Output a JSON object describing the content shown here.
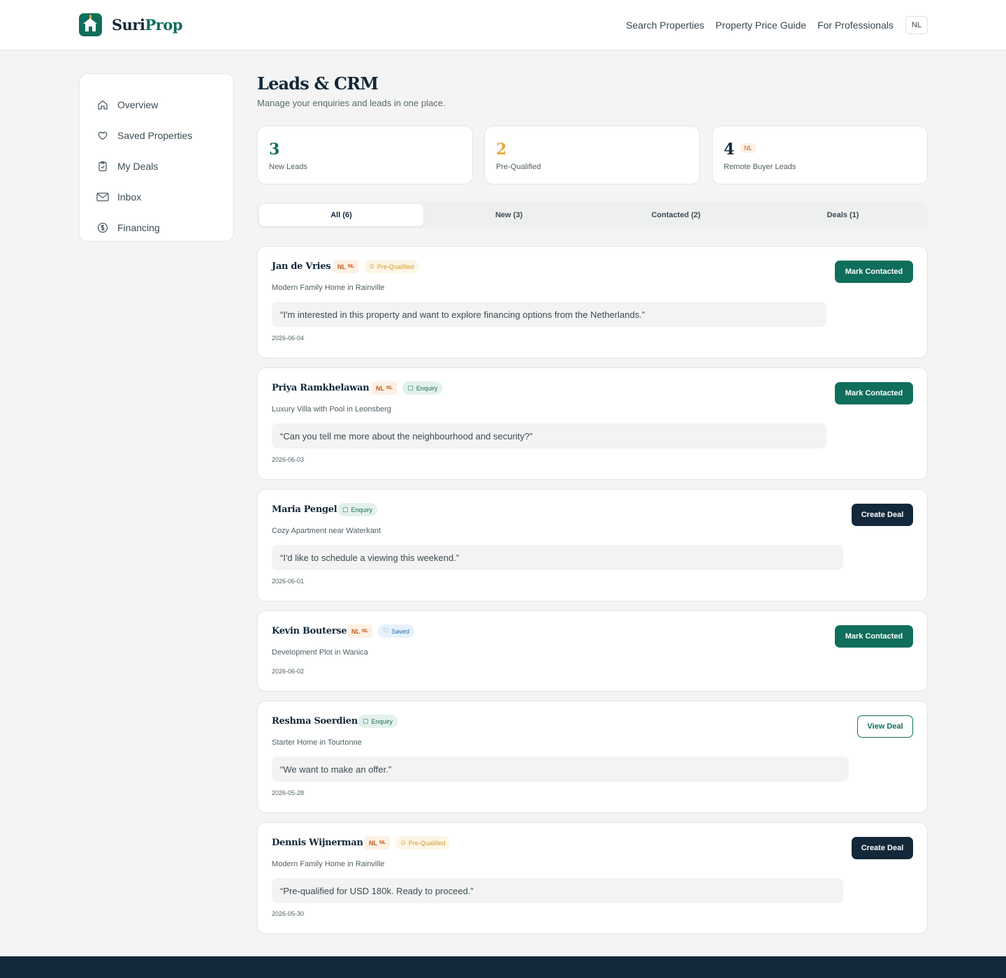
{
  "brand": {
    "name_a": "Suri",
    "name_b": "Prop"
  },
  "nav": {
    "links": [
      "Search Properties",
      "Property Price Guide",
      "For Professionals"
    ],
    "lang": "NL"
  },
  "sidebar": {
    "items": [
      {
        "label": "Overview",
        "icon": "home-icon"
      },
      {
        "label": "Saved Properties",
        "icon": "heart-icon"
      },
      {
        "label": "My Deals",
        "icon": "clipboard-check-icon"
      },
      {
        "label": "Inbox",
        "icon": "mail-icon"
      },
      {
        "label": "Financing",
        "icon": "dollar-circle-icon"
      }
    ]
  },
  "page": {
    "title": "Leads & CRM",
    "subtitle": "Manage your enquiries and leads in one place."
  },
  "stats": [
    {
      "value": "3",
      "label": "New Leads",
      "color": "#0f6e5c"
    },
    {
      "value": "2",
      "label": "Pre-Qualified",
      "color": "#e5a93a"
    },
    {
      "value": "4",
      "label": "Remote Buyer Leads",
      "color": "#13283a",
      "badge": "NL"
    }
  ],
  "tabs": [
    "All (6)",
    "New (3)",
    "Contacted (2)",
    "Deals (1)"
  ],
  "leads": [
    {
      "name": "Jan de Vries",
      "nl": true,
      "status": "Pre-Qualified",
      "status_type": "preq",
      "property": "Modern Family Home in Rainville",
      "message": "“I'm interested in this property and want to explore financing options from the Netherlands.”",
      "date": "2026-06-04",
      "action": "Mark Contacted",
      "action_type": "green"
    },
    {
      "name": "Priya Ramkhelawan",
      "nl": true,
      "status": "Enquiry",
      "status_type": "enq",
      "property": "Luxury Villa with Pool in Leonsberg",
      "message": "“Can you tell me more about the neighbourhood and security?”",
      "date": "2026-06-03",
      "action": "Mark Contacted",
      "action_type": "green"
    },
    {
      "name": "Maria Pengel",
      "nl": false,
      "status": "Enquiry",
      "status_type": "enq",
      "property": "Cozy Apartment near Waterkant",
      "message": "“I'd like to schedule a viewing this weekend.”",
      "date": "2026-06-01",
      "action": "Create Deal",
      "action_type": "dark"
    },
    {
      "name": "Kevin Bouterse",
      "nl": true,
      "status": "Saved",
      "status_type": "saved",
      "property": "Development Plot in Wanica",
      "message": "",
      "date": "2026-06-02",
      "action": "Mark Contacted",
      "action_type": "green"
    },
    {
      "name": "Reshma Soerdien",
      "nl": false,
      "status": "Enquiry",
      "status_type": "enq",
      "property": "Starter Home in Tourtonne",
      "message": "“We want to make an offer.”",
      "date": "2026-05-28",
      "action": "View Deal",
      "action_type": "outline"
    },
    {
      "name": "Dennis Wijnerman",
      "nl": true,
      "status": "Pre-Qualified",
      "status_type": "preq",
      "property": "Modern Family Home in Rainville",
      "message": "“Pre-qualified for USD 180k. Ready to proceed.”",
      "date": "2026-05-30",
      "action": "Create Deal",
      "action_type": "dark"
    }
  ],
  "nl_badge": {
    "text": "NL",
    "small": "NL"
  }
}
